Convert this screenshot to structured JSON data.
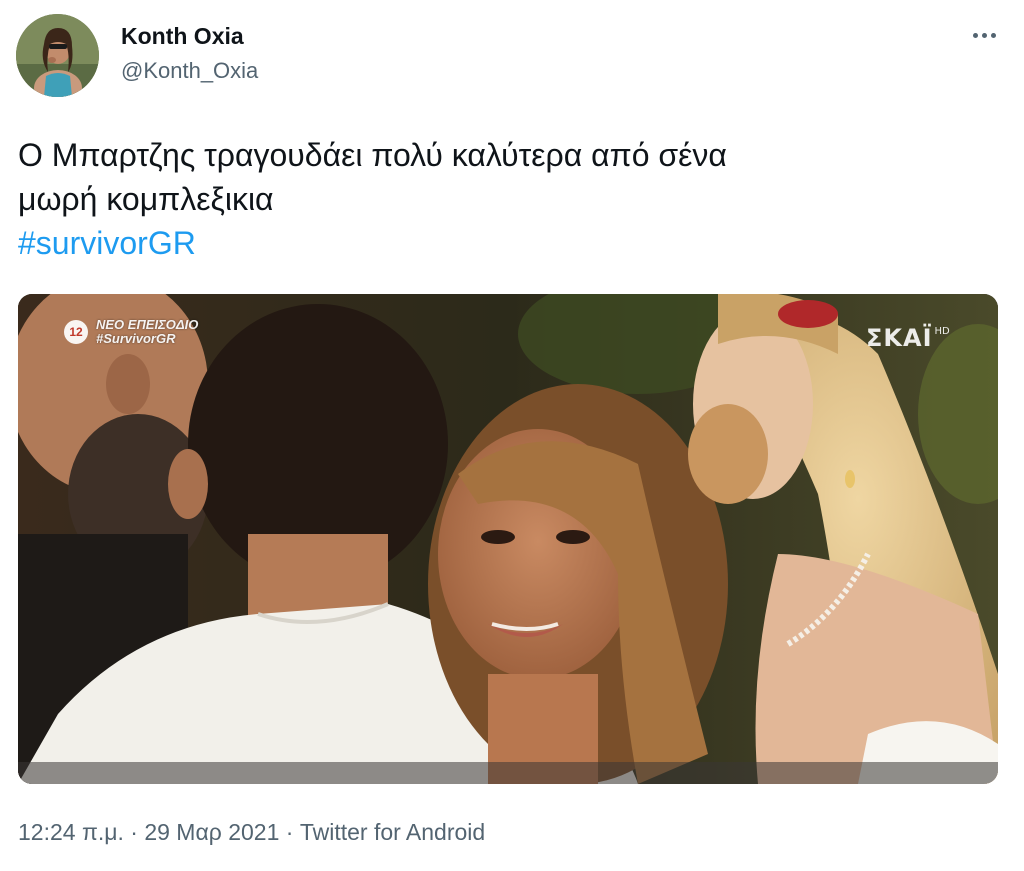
{
  "author": {
    "display_name": "Konth Oxia",
    "handle": "@Konth_Oxia",
    "avatar_icon": "user-avatar"
  },
  "tweet": {
    "text_line1": "Ο Μπαρτζης τραγουδάει πολύ καλύτερα από σένα",
    "text_line2": "μωρή κομπλεξικια",
    "hashtag": "#survivorGR"
  },
  "media": {
    "badge_number": "12",
    "badge_line1": "ΝΕΟ ΕΠΕΙΣΟΔΙΟ",
    "badge_line2": "#SurvivorGR",
    "channel_name": "ΣΚΑΪ",
    "channel_quality": "HD"
  },
  "meta": {
    "time": "12:24 π.μ.",
    "separator1": " · ",
    "date": "29 Μαρ 2021",
    "separator2": " · ",
    "source": "Twitter for Android"
  },
  "colors": {
    "text_primary": "#0f1419",
    "text_secondary": "#536471",
    "link": "#1d9bf0"
  }
}
